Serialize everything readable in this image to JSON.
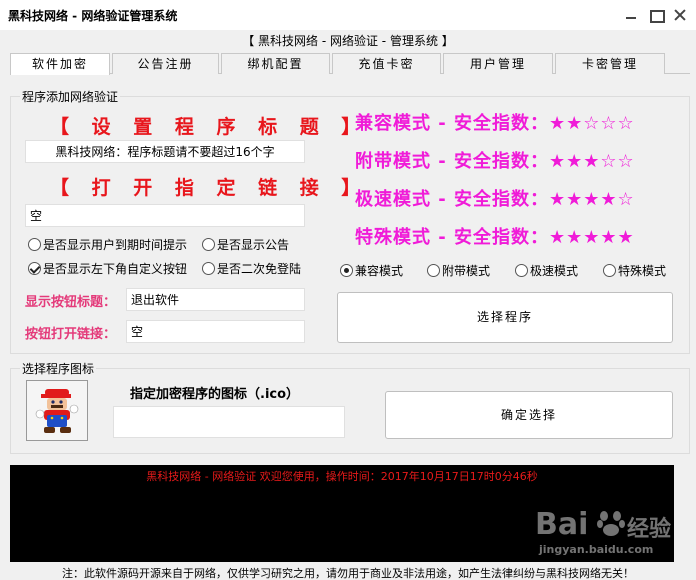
{
  "window": {
    "title": "黑科技网络 - 网络验证管理系统",
    "subtitle": "【 黑科技网络 - 网络验证 - 管理系统 】"
  },
  "tabs": [
    {
      "label": "软件加密",
      "active": true
    },
    {
      "label": "公告注册",
      "active": false
    },
    {
      "label": "绑机配置",
      "active": false
    },
    {
      "label": "充值卡密",
      "active": false
    },
    {
      "label": "用户管理",
      "active": false
    },
    {
      "label": "卡密管理",
      "active": false
    }
  ],
  "program_group": {
    "title": "程序添加网络验证",
    "set_title_heading": "【 设 置 程 序 标 题 】",
    "title_value": "黑科技网络：程序标题请不要超过16个字",
    "open_link_heading": "【 打 开 指 定 链 接 】",
    "link_value": "空",
    "options": {
      "show_expiry": {
        "label": "是否显示用户到期时间提示",
        "checked": false
      },
      "show_notice": {
        "label": "是否显示公告",
        "checked": false
      },
      "show_custom_button": {
        "label": "是否显示左下角自定义按钮",
        "checked": true
      },
      "second_auto_login": {
        "label": "是否二次免登陆",
        "checked": false
      }
    },
    "button_title_label": "显示按钮标题：",
    "button_title_value": "退出软件",
    "button_link_label": "按钮打开链接：",
    "button_link_value": "空",
    "modes": [
      {
        "text": "兼容模式 - 安全指数：★★☆☆☆",
        "safety": 2
      },
      {
        "text": "附带模式 - 安全指数：★★★☆☆",
        "safety": 3
      },
      {
        "text": "极速模式 - 安全指数：★★★★☆",
        "safety": 4
      },
      {
        "text": "特殊模式 - 安全指数：★★★★★",
        "safety": 5
      }
    ],
    "mode_radios": [
      {
        "label": "兼容模式",
        "checked": true
      },
      {
        "label": "附带模式",
        "checked": false
      },
      {
        "label": "极速模式",
        "checked": false
      },
      {
        "label": "特殊模式",
        "checked": false
      }
    ],
    "select_program_label": "选择程序"
  },
  "icon_group": {
    "title": "选择程序图标",
    "instruction": "指定加密程序的图标（.ico）",
    "icon_path_value": "",
    "confirm_label": "确定选择"
  },
  "console": {
    "message": "黑科技网络 - 网络验证 欢迎您使用，操作时间：2017年10月17日17时0分46秒"
  },
  "footer": {
    "notice": "注：此软件源码开源来自于网络，仅供学习研究之用，请勿用于商业及非法用途，如产生法律纠纷与黑科技网络无关！"
  },
  "watermark": {
    "brand": "Bai",
    "brand_tail": "经验",
    "url": "jingyan.baidu.com"
  },
  "colors": {
    "heading_red": "#e8161c",
    "label_pink": "#e43a7a",
    "mode_magenta": "#f01bd8",
    "console_bg": "#000000",
    "console_text": "#e81a1a"
  }
}
